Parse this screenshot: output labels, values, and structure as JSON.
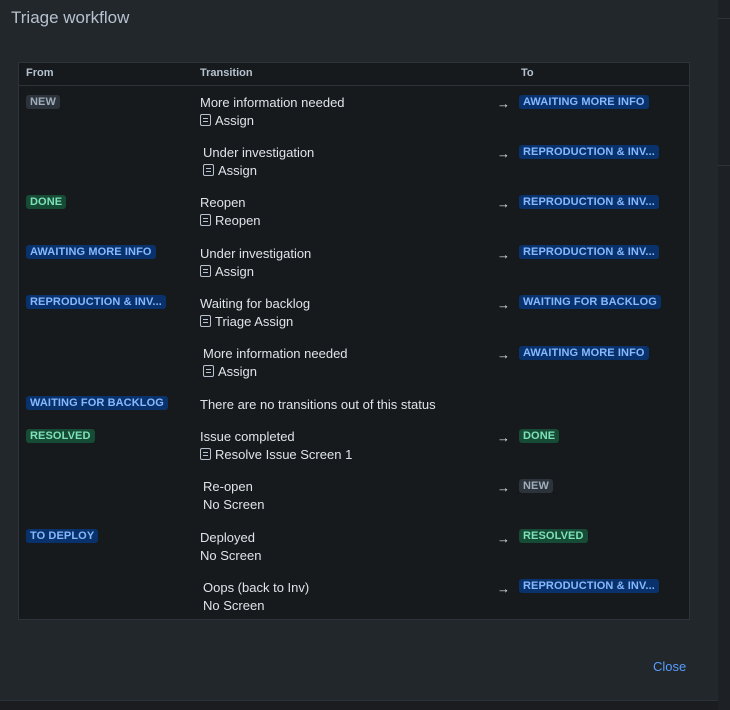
{
  "dialog": {
    "title": "Triage workflow",
    "close_label": "Close"
  },
  "table": {
    "headers": {
      "from": "From",
      "transition": "Transition",
      "to": "To"
    },
    "arrow": "→",
    "rows": [
      {
        "from": "NEW",
        "from_color": "grey",
        "transition": "More information needed",
        "screen": "Assign",
        "screen_icon": true,
        "to": "AWAITING MORE INFO",
        "to_color": "blue"
      },
      {
        "from": "",
        "transition": "Under investigation",
        "screen": "Assign",
        "screen_icon": true,
        "to": "REPRODUCTION & INV...",
        "to_color": "blue"
      },
      {
        "from": "DONE",
        "from_color": "green",
        "transition": "Reopen",
        "screen": "Reopen",
        "screen_icon": true,
        "to": "REPRODUCTION & INV...",
        "to_color": "blue"
      },
      {
        "from": "AWAITING MORE INFO",
        "from_color": "blue",
        "transition": "Under investigation",
        "screen": "Assign",
        "screen_icon": true,
        "to": "REPRODUCTION & INV...",
        "to_color": "blue"
      },
      {
        "from": "REPRODUCTION & INV...",
        "from_color": "blue",
        "transition": "Waiting for backlog",
        "screen": "Triage Assign",
        "screen_icon": true,
        "to": "WAITING FOR BACKLOG",
        "to_color": "blue"
      },
      {
        "from": "",
        "transition": "More information needed",
        "screen": "Assign",
        "screen_icon": true,
        "to": "AWAITING MORE INFO",
        "to_color": "blue"
      },
      {
        "from": "WAITING FOR BACKLOG",
        "from_color": "blue",
        "transition": "There are no transitions out of this status",
        "screen": "",
        "screen_icon": false,
        "to": "",
        "to_color": ""
      },
      {
        "from": "RESOLVED",
        "from_color": "green",
        "transition": "Issue completed",
        "screen": "Resolve Issue Screen 1",
        "screen_icon": true,
        "to": "DONE",
        "to_color": "green"
      },
      {
        "from": "",
        "transition": "Re-open",
        "screen": "No Screen",
        "screen_icon": false,
        "to": "NEW",
        "to_color": "grey"
      },
      {
        "from": "TO DEPLOY",
        "from_color": "blue",
        "transition": "Deployed",
        "screen": "No Screen",
        "screen_icon": false,
        "to": "RESOLVED",
        "to_color": "green"
      },
      {
        "from": "",
        "transition": "Oops (back to Inv)",
        "screen": "No Screen",
        "screen_icon": false,
        "to": "REPRODUCTION & INV...",
        "to_color": "blue"
      }
    ]
  }
}
